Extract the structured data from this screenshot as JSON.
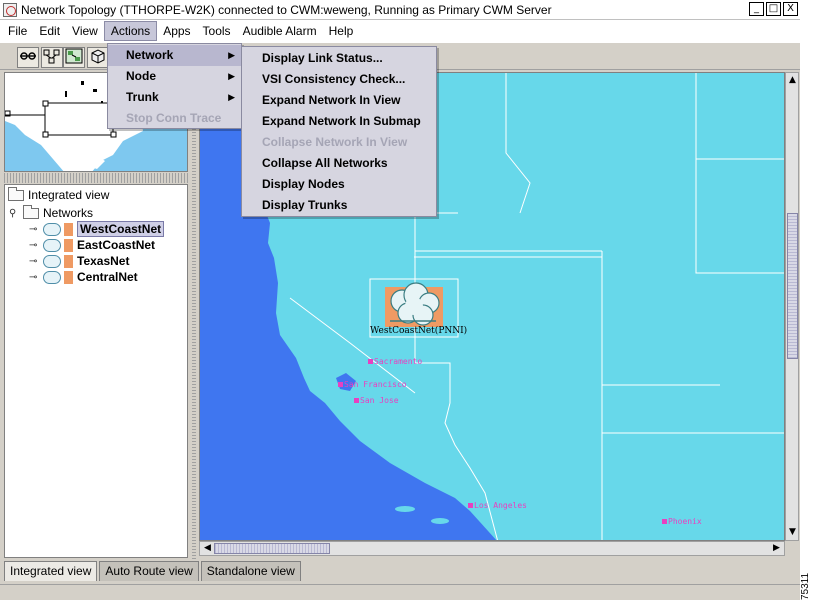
{
  "window": {
    "title": "Network Topology  (TTHORPE-W2K) connected to CWM:weweng, Running as Primary CWM Server",
    "minimize": "_",
    "maximize": "□",
    "close": "X"
  },
  "menubar": {
    "items": [
      "File",
      "Edit",
      "View",
      "Actions",
      "Apps",
      "Tools",
      "Audible Alarm",
      "Help"
    ],
    "active": "Actions"
  },
  "actions_menu": {
    "items": [
      {
        "label": "Network",
        "submenu": true,
        "active": true
      },
      {
        "label": "Node",
        "submenu": true
      },
      {
        "label": "Trunk",
        "submenu": true
      },
      {
        "label": "Stop Conn Trace",
        "disabled": true
      }
    ]
  },
  "network_submenu": {
    "items": [
      {
        "label": "Display Link Status..."
      },
      {
        "label": "VSI Consistency Check..."
      },
      {
        "label": "Expand Network In View"
      },
      {
        "label": "Expand Network In Submap"
      },
      {
        "label": "Collapse Network In View",
        "disabled": true
      },
      {
        "label": "Collapse All Networks"
      },
      {
        "label": "Display Nodes"
      },
      {
        "label": "Display Trunks"
      }
    ]
  },
  "tree": {
    "root": "Integrated view",
    "networks_folder": "Networks",
    "networks": [
      "WestCoastNet",
      "EastCoastNet",
      "TexasNet",
      "CentralNet"
    ],
    "selected": "WestCoastNet"
  },
  "map": {
    "network_node_label": "WestCoastNet(PNNI)",
    "cities": [
      "Sacramento",
      "San Francisco",
      "San Jose",
      "Los Angeles",
      "Phoenix"
    ],
    "colors": {
      "land": "#67d8ea",
      "ocean": "#3f76f0",
      "border": "#ffffff",
      "city": "#e840c0",
      "node": "#ef9a63"
    }
  },
  "tabs": [
    "Integrated view",
    "Auto Route view",
    "Standalone view"
  ],
  "active_tab": "Integrated view",
  "figure_id": "75311"
}
